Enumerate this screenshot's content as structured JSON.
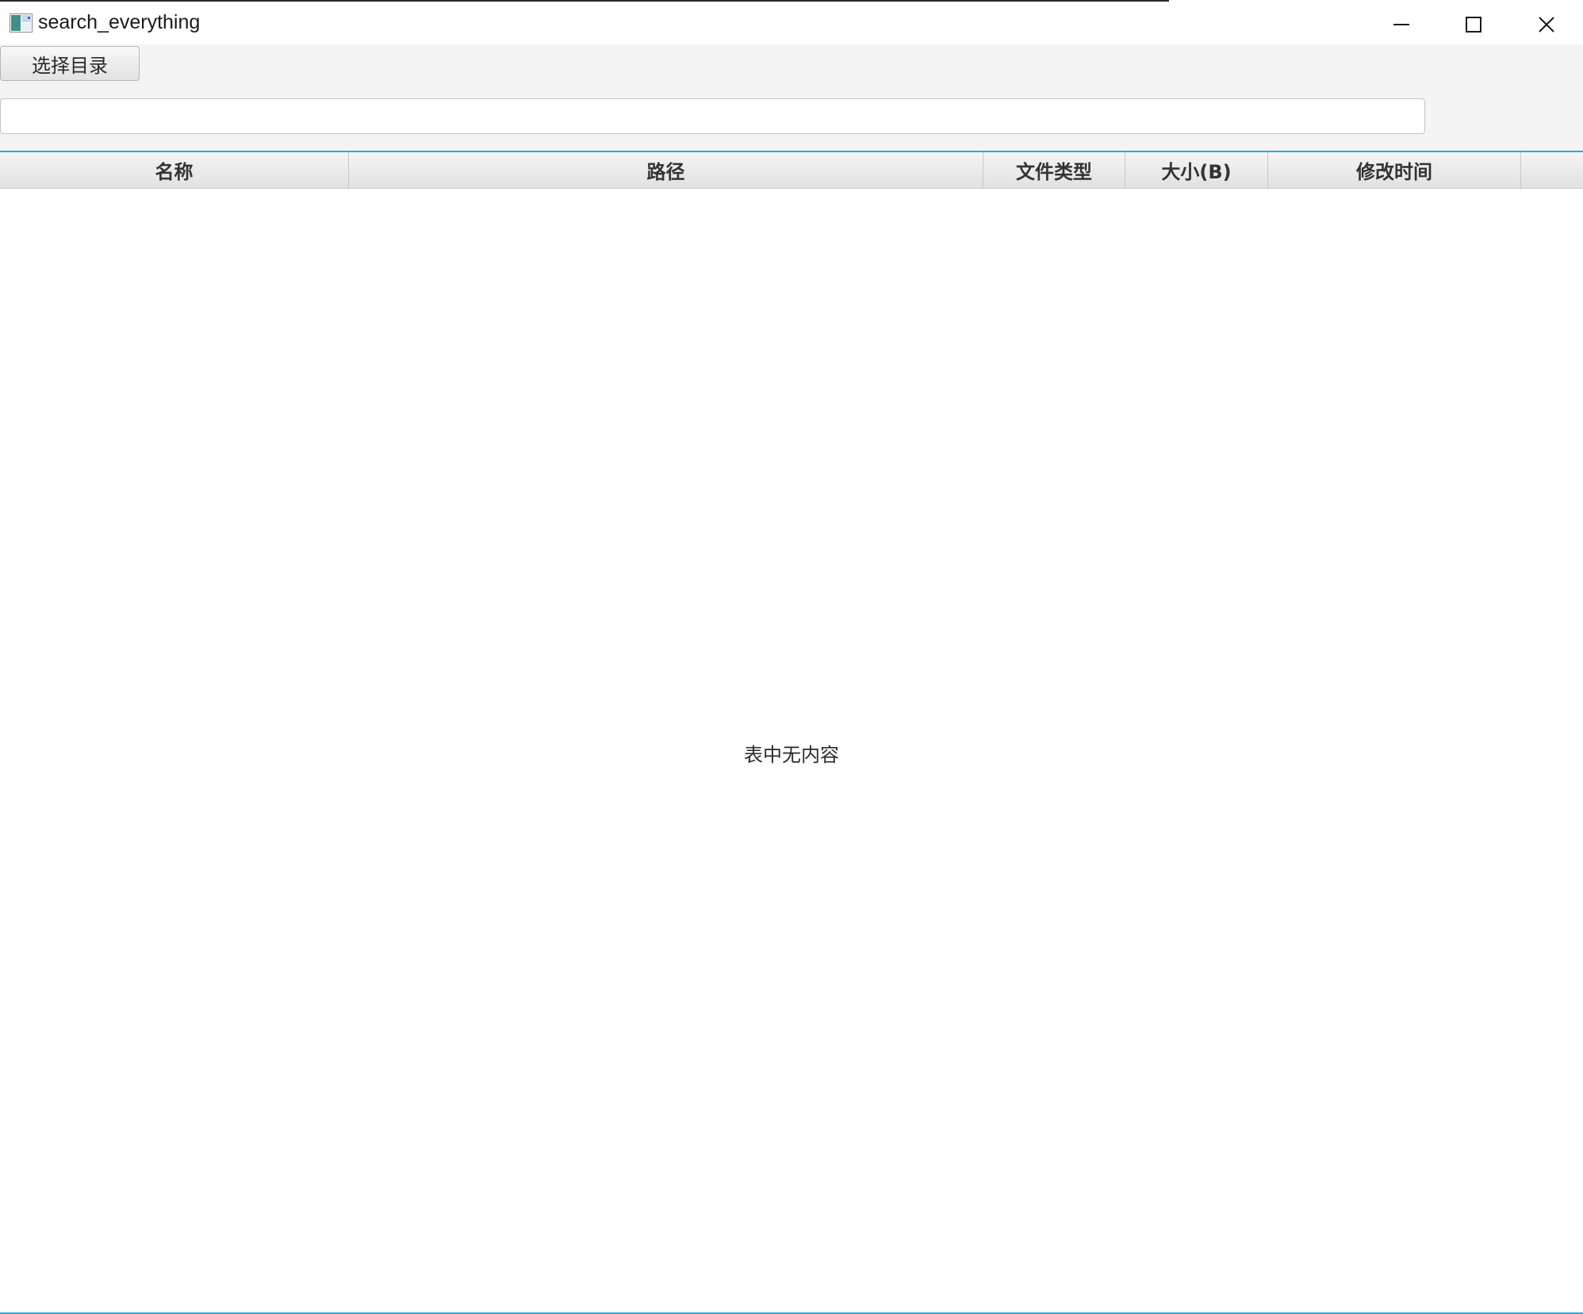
{
  "window": {
    "title": "search_everything",
    "controls": [
      "minimize-icon",
      "maximize-icon",
      "close-icon"
    ]
  },
  "toolbar": {
    "choose_dir_label": "选择目录",
    "search_value": "",
    "search_placeholder": ""
  },
  "table": {
    "columns": [
      "名称",
      "路径",
      "文件类型",
      "大小(B)",
      "修改时间"
    ],
    "rows": [],
    "empty_message": "表中无内容"
  },
  "colors": {
    "accent": "#3aa6d8",
    "toolbar_bg": "#f4f4f4",
    "header_bg": "#e8e8e8"
  }
}
